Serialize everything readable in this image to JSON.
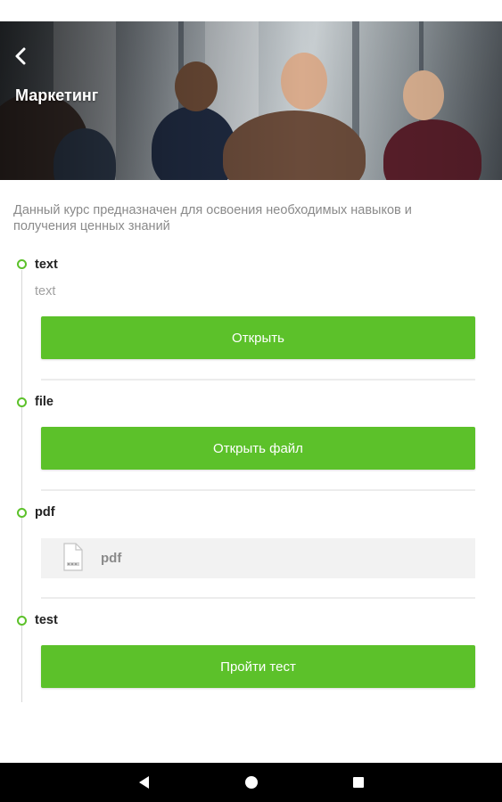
{
  "header": {
    "title": "Маркетинг",
    "back_icon": "chevron-left-icon"
  },
  "course": {
    "description": "Данный курс предназначен для освоения необходимых навыков и получения ценных знаний"
  },
  "items": [
    {
      "title": "text",
      "text": "text",
      "button_label": "Открыть"
    },
    {
      "title": "file",
      "button_label": "Открыть файл"
    },
    {
      "title": "pdf",
      "file_name": "pdf",
      "file_icon": "document-icon"
    },
    {
      "title": "test",
      "button_label": "Пройти тест"
    }
  ],
  "colors": {
    "accent": "#5cc12a",
    "divider": "#ececec",
    "file_card_bg": "#f2f2f2"
  },
  "navigation_bar": {
    "back": "nav-back-icon",
    "home": "nav-home-icon",
    "recents": "nav-recents-icon"
  }
}
